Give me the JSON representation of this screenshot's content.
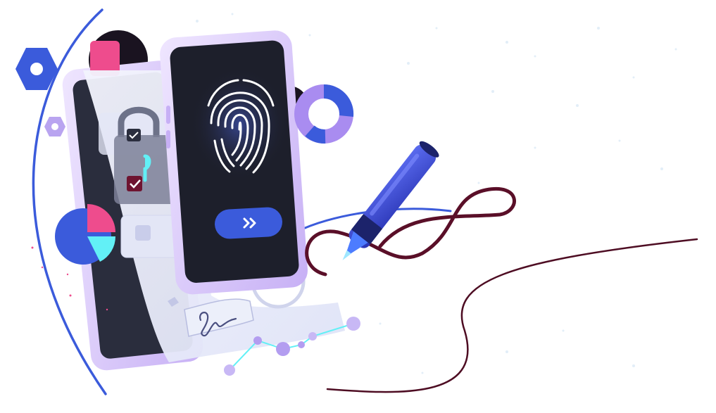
{
  "scene": {
    "description_free": true
  },
  "colors": {
    "background": "#ffffff",
    "phone_frame": "#d9c8f7",
    "phone_frame_edge": "#b79cf0",
    "phone_screen": "#1d1f2b",
    "paper": "#eef0fb",
    "card": "#e3e6f6",
    "blue": "#3b5bdb",
    "blue_light": "#4d7cff",
    "lavender": "#a98cf0",
    "pink": "#ee4c8d",
    "cyan": "#62f0f6",
    "maroon": "#5a0f28",
    "pen_body": "#3f4fd6",
    "pen_dark": "#1c236b",
    "fingerprint": "#ffffff"
  },
  "icons": {
    "fingerprint": "fingerprint-icon",
    "padlock": "padlock-icon",
    "next": "double-chevron-right-icon",
    "hex_nut": "hex-nut-icon",
    "donut_chart": "donut-chart-icon",
    "pie_chart": "pie-chart-icon",
    "pen": "pen-icon",
    "signature": "signature-icon",
    "checkbox": "checkbox-icon"
  }
}
